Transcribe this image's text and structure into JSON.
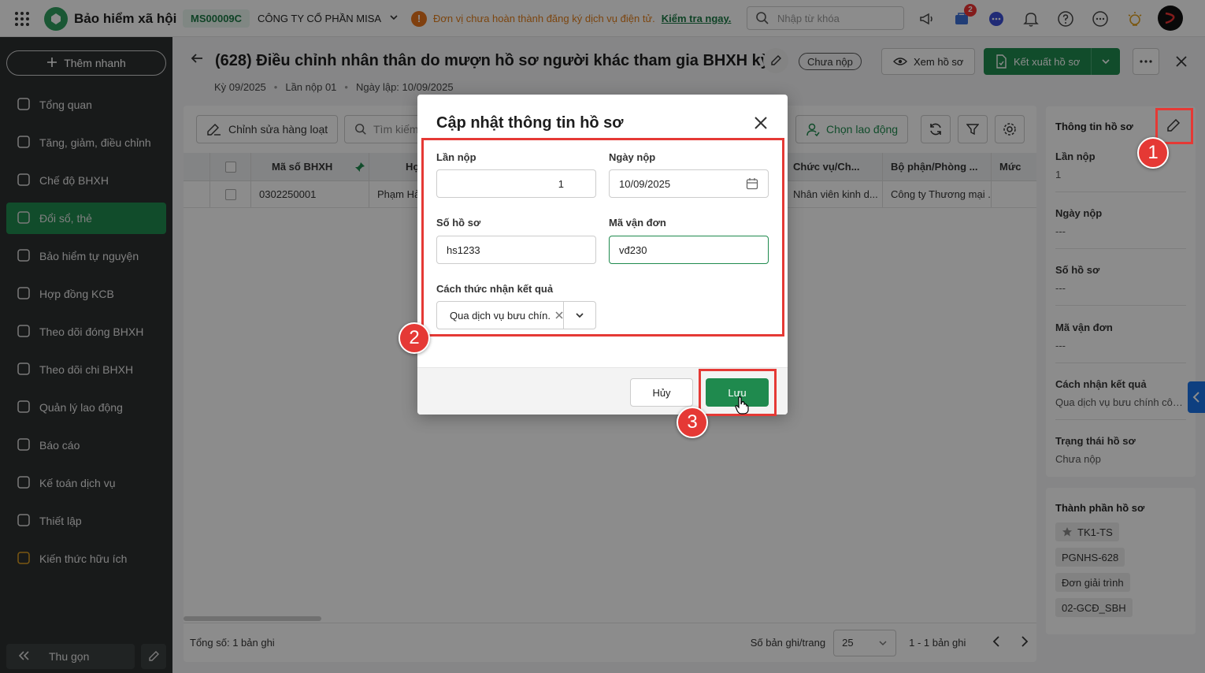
{
  "topbar": {
    "brand_name": "Bảo hiểm xã hội",
    "company_code": "MS00009C",
    "company_name": "CÔNG TY CỔ PHẦN MISA",
    "warning_text": "Đơn vị chưa hoàn thành đăng ký dịch vụ điện tử.",
    "warning_link": "Kiểm tra ngay.",
    "search_placeholder": "Nhập từ khóa",
    "cart_badge": "2"
  },
  "sidebar": {
    "quick_add": "Thêm nhanh",
    "items": [
      {
        "label": "Tổng quan",
        "icon": "home-icon"
      },
      {
        "label": "Tăng, giảm, điều chỉnh",
        "icon": "user-adjust-icon"
      },
      {
        "label": "Chế độ BHXH",
        "icon": "shield-icon"
      },
      {
        "label": "Đổi sổ, thẻ",
        "icon": "card-icon"
      },
      {
        "label": "Bảo hiểm tự nguyện",
        "icon": "shield-check-icon"
      },
      {
        "label": "Hợp đồng KCB",
        "icon": "contract-icon"
      },
      {
        "label": "Theo dõi đóng BHXH",
        "icon": "ledger-icon"
      },
      {
        "label": "Theo dõi chi BHXH",
        "icon": "ledger-out-icon"
      },
      {
        "label": "Quản lý lao động",
        "icon": "people-icon"
      },
      {
        "label": "Báo cáo",
        "icon": "report-icon"
      },
      {
        "label": "Kế toán dịch vụ",
        "icon": "accounting-icon"
      },
      {
        "label": "Thiết lập",
        "icon": "settings-icon"
      },
      {
        "label": "Kiến thức hữu ích",
        "icon": "bulb-icon"
      }
    ],
    "active_index": 3,
    "collapse_label": "Thu gọn"
  },
  "page": {
    "title": "(628) Điều chỉnh nhân thân do mượn hồ sơ người khác tham gia BHXH kỳ ...",
    "period": "Kỳ 09/2025",
    "submission": "Lần nộp 01",
    "created": "Ngày lập: 10/09/2025",
    "status": "Chưa nộp",
    "view_btn": "Xem hồ sơ",
    "export_btn": "Kết xuất hồ sơ"
  },
  "toolbar": {
    "bulk_edit": "Chỉnh sửa hàng loạt",
    "search_placeholder": "Tìm kiếm",
    "choose_employee": "Chọn lao động"
  },
  "table": {
    "headers": [
      "Mã số BHXH",
      "Họ",
      "Chức vụ/Ch...",
      "Bộ phận/Phòng ...",
      "Mức"
    ],
    "row": [
      "0302250001",
      "Phạm Hả",
      "Nhân viên kinh d...",
      "Công ty Thương mại ..."
    ]
  },
  "footer": {
    "total": "Tổng số: 1 bản ghi",
    "per_page_label": "Số bản ghi/trang",
    "per_page": "25",
    "range": "1 - 1 bản ghi"
  },
  "right_panel": {
    "title": "Thông tin hồ sơ",
    "fields": [
      {
        "label": "Lần nộp",
        "value": "1"
      },
      {
        "label": "Ngày nộp",
        "value": "---"
      },
      {
        "label": "Số hồ sơ",
        "value": "---"
      },
      {
        "label": "Mã vận đơn",
        "value": "---"
      },
      {
        "label": "Cách nhận kết quả",
        "value": "Qua dịch vụ bưu chính côn..."
      },
      {
        "label": "Trạng thái hồ sơ",
        "value": "Chưa nộp"
      }
    ],
    "components_title": "Thành phần hồ sơ",
    "components": [
      "TK1-TS",
      "PGNHS-628",
      "Đơn giải trình",
      "02-GCĐ_SBH"
    ]
  },
  "dialog": {
    "title": "Cập nhật thông tin hồ sơ",
    "submission_label": "Lần nộp",
    "submission_value": "1",
    "date_label": "Ngày nộp",
    "date_value": "10/09/2025",
    "file_no_label": "Số hồ sơ",
    "file_no_value": "hs1233",
    "waybill_label": "Mã vận đơn",
    "waybill_value": "vđ230",
    "method_label": "Cách thức nhận kết quả",
    "method_value": "Qua dịch vụ bưu chín.",
    "cancel": "Hủy",
    "save": "Lưu"
  },
  "annotations": {
    "step1": "1",
    "step2": "2",
    "step3": "3",
    "color": "#e53935"
  }
}
